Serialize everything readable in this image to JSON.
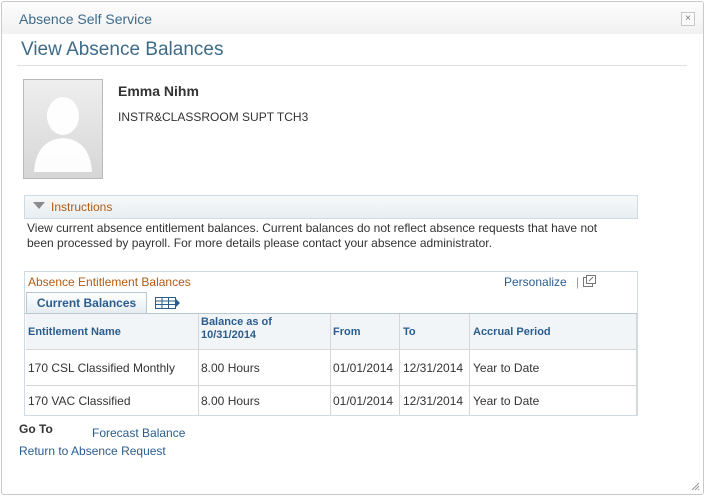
{
  "window": {
    "title": "Absence Self Service",
    "close_symbol": "×"
  },
  "page": {
    "title": "View Absence Balances"
  },
  "employee": {
    "name": "Emma Nihm",
    "job_title": "INSTR&CLASSROOM SUPT TCH3",
    "photo_icon": "person-silhouette-icon"
  },
  "instructions": {
    "label": "Instructions",
    "text": "View current absence entitlement balances. Current balances do not reflect absence requests that have not been processed by payroll. For more details please contact your absence administrator."
  },
  "grid": {
    "title": "Absence Entitlement Balances",
    "personalize_label": "Personalize",
    "separator": "|",
    "tab_label": "Current Balances",
    "columns": [
      "Entitlement Name",
      "Balance as of 10/31/2014",
      "From",
      "To",
      "Accrual Period"
    ],
    "rows": [
      [
        "170 CSL Classified Monthly",
        "8.00 Hours",
        "01/01/2014",
        "12/31/2014",
        "Year to Date"
      ],
      [
        "170 VAC Classified",
        "8.00 Hours",
        "01/01/2014",
        "12/31/2014",
        "Year to Date"
      ]
    ]
  },
  "goto": {
    "label": "Go To",
    "links": [
      "Forecast Balance",
      "Return to Absence Request"
    ]
  },
  "colors": {
    "title_blue": "#3e6b8a",
    "link_blue": "#2a5d8e",
    "label_orange": "#b35b11"
  }
}
